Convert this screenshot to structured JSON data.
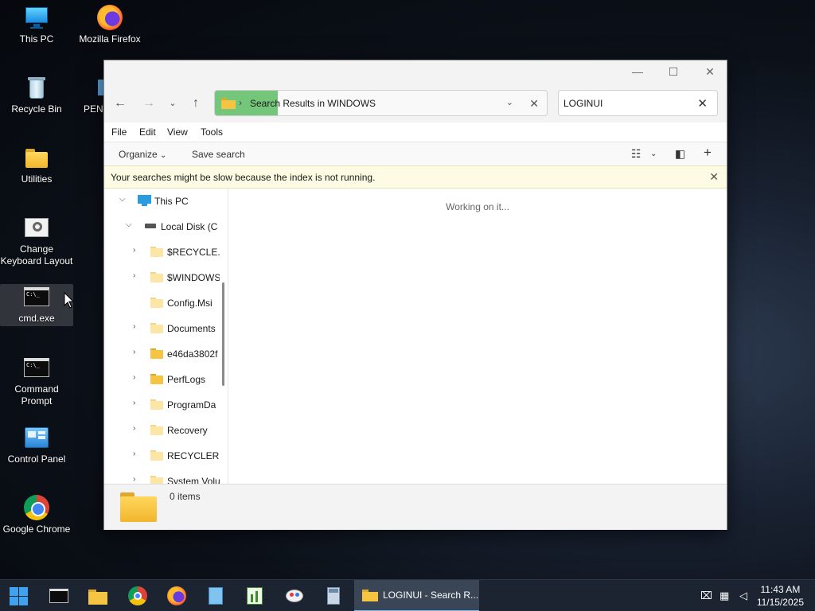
{
  "desktop": {
    "icons": [
      {
        "label": "This PC",
        "icon": "this-pc-icon"
      },
      {
        "label": "Mozilla Firefox",
        "icon": "firefox-icon"
      },
      {
        "label": "Recycle Bin",
        "icon": "recycle-bin-icon"
      },
      {
        "label": "PEN",
        "icon": "partial-icon"
      },
      {
        "label": "Utilities",
        "icon": "folder-icon"
      },
      {
        "label": "Change Keyboard Layout",
        "icon": "keyboard-layout-icon"
      },
      {
        "label": "cmd.exe",
        "icon": "cmd-icon"
      },
      {
        "label": "Command Prompt",
        "icon": "cmd-icon"
      },
      {
        "label": "Control Panel",
        "icon": "control-panel-icon"
      },
      {
        "label": "Google Chrome",
        "icon": "chrome-icon"
      }
    ]
  },
  "window": {
    "caption": {
      "minimize": "—",
      "maximize": "☐",
      "close": "✕"
    },
    "address": {
      "separator": "›",
      "prefix": "Search",
      "rest": " Results in WINDOWS",
      "progress": 0.19,
      "progress_color": "#74c77a"
    },
    "search": {
      "value": "LOGINUI"
    },
    "menu": [
      "File",
      "Edit",
      "View",
      "Tools"
    ],
    "toolbar": {
      "organize": "Organize",
      "save_search": "Save search"
    },
    "info_bar": {
      "text": "Your searches might be slow because the index is not running."
    },
    "tree": [
      {
        "label": "This PC",
        "level": 0,
        "expanded": true,
        "type": "pc"
      },
      {
        "label": "Local Disk (C",
        "level": 1,
        "expanded": true,
        "type": "disk"
      },
      {
        "label": "$RECYCLE.E",
        "level": 2,
        "chevron": true,
        "type": "folder-pale"
      },
      {
        "label": "$WINDOWS",
        "level": 2,
        "chevron": true,
        "type": "folder-pale"
      },
      {
        "label": "Config.Msi",
        "level": 2,
        "chevron": false,
        "type": "folder-pale"
      },
      {
        "label": "Documents",
        "level": 2,
        "chevron": true,
        "type": "folder-pale"
      },
      {
        "label": "e46da3802f",
        "level": 2,
        "chevron": true,
        "type": "folder"
      },
      {
        "label": "PerfLogs",
        "level": 2,
        "chevron": true,
        "type": "folder"
      },
      {
        "label": "ProgramDa",
        "level": 2,
        "chevron": true,
        "type": "folder-pale"
      },
      {
        "label": "Recovery",
        "level": 2,
        "chevron": true,
        "type": "folder-pale"
      },
      {
        "label": "RECYCLER",
        "level": 2,
        "chevron": true,
        "type": "folder-pale"
      },
      {
        "label": "System Volu",
        "level": 2,
        "chevron": true,
        "type": "folder-pale"
      }
    ],
    "content": {
      "status": "Working on it..."
    },
    "details": {
      "count": "0 items"
    }
  },
  "taskbar": {
    "active_window": "LOGINUI - Search R...",
    "time": "11:43 AM",
    "date": "11/15/2025",
    "accent": "#3fa2ef"
  }
}
